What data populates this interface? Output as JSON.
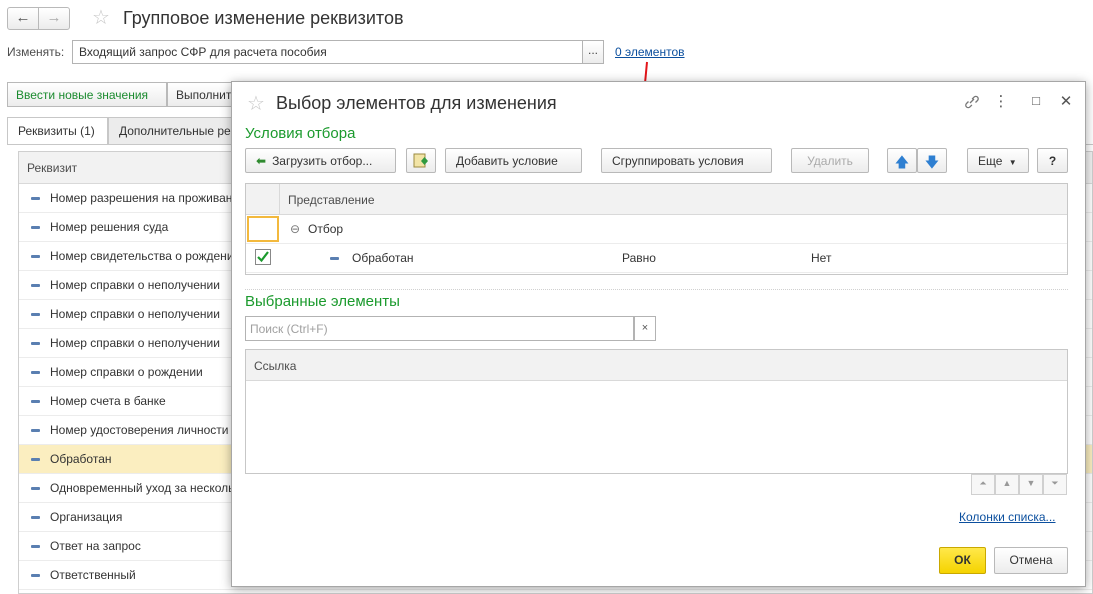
{
  "main": {
    "title": "Групповое изменение реквизитов",
    "nav_back": "←",
    "nav_forward": "→",
    "edit_label": "Изменять:",
    "edit_value": "Входящий запрос СФР для расчета пособия",
    "select_button": "...",
    "count_link": "0 элементов",
    "buttons": {
      "enter_values": "Ввести новые значения",
      "execute": "Выполнить"
    },
    "tabs": {
      "requisites": "Реквизиты (1)",
      "additional": "Дополнительные реквизиты"
    },
    "grid_header": "Реквизит",
    "rows": [
      "Номер разрешения на проживание",
      "Номер решения суда",
      "Номер свидетельства о рождении",
      "Номер справки о неполучении",
      "Номер справки о неполучении",
      "Номер справки о неполучении",
      "Номер справки о рождении",
      "Номер счета в банке",
      "Номер удостоверения личности",
      "Обработан",
      "Одновременный уход за несколькими",
      "Организация",
      "Ответ на запрос",
      "Ответственный"
    ],
    "selected_row_index": 9
  },
  "dialog": {
    "title": "Выбор элементов для изменения",
    "filter_section_title": "Условия отбора",
    "buttons": {
      "load_filter": "Загрузить отбор...",
      "add_condition": "Добавить условие",
      "group_conditions": "Сгруппировать условия",
      "delete": "Удалить",
      "more": "Еще",
      "help": "?"
    },
    "filter_grid": {
      "header": "Представление",
      "group_row": "Отбор",
      "condition": {
        "field": "Обработан",
        "comparison": "Равно",
        "value": "Нет",
        "checked": true
      }
    },
    "selected_section_title": "Выбранные элементы",
    "search_placeholder": "Поиск (Ctrl+F)",
    "search_clear": "×",
    "link_grid_header": "Ссылка",
    "list_columns_link": "Колонки списка...",
    "ok_label": "ОК",
    "cancel_label": "Отмена"
  },
  "colors": {
    "accent_green": "#1b9a2d",
    "link_blue": "#0b4f9e",
    "ok_yellow": "#f5d300",
    "selected_row": "#fbeec0",
    "arrow_red": "#e3151a"
  }
}
